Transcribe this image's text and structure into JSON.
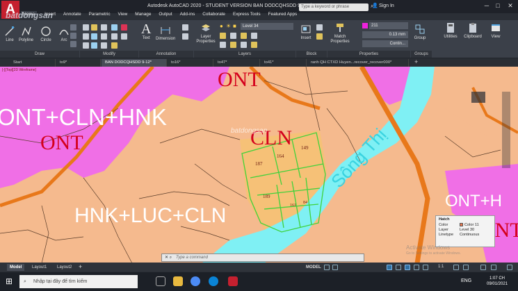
{
  "app": {
    "logo": "A",
    "title": "Autodesk AutoCAD 2020 - STUDENT VERSION   BAN DODCQHSDD 9-12.dwg",
    "search_placeholder": "Type a keyword or phrase",
    "sign_in": "Sign In",
    "watermark_site": "batdongsan",
    "watermark_site_sub": ".com.vn"
  },
  "menu": [
    "Home",
    "Insert",
    "Annotate",
    "Parametric",
    "View",
    "Manage",
    "Output",
    "Add-ins",
    "Collaborate",
    "Express Tools",
    "Featured Apps"
  ],
  "ribbon": {
    "draw_tools": [
      "Line",
      "Polyline",
      "Circle",
      "Arc"
    ],
    "panels": {
      "draw": "Draw",
      "modify": "Modify",
      "annotation": "Annotation",
      "layers": "Layers",
      "block": "Block",
      "properties": "Properties",
      "groups": "Groups"
    },
    "buttons": {
      "text": "Text",
      "dimension": "Dimension",
      "layer_properties": "Layer Properties",
      "insert": "Insert",
      "match_properties": "Match Properties",
      "group": "Group",
      "utilities": "Utilities",
      "clipboard": "Clipboard",
      "view": "View"
    },
    "layer_current": "Level 34",
    "color_value": "211",
    "lineweight_value": "0.13 mm",
    "linetype_value": "Contin..."
  },
  "file_tabs": [
    "Start",
    "to9*",
    "BAN DODCQHSDD 9-12*",
    "to16*",
    "to47*",
    "to41*",
    "ranh QH CTXD Huyen...recover_recover000*"
  ],
  "viewport": {
    "label": "[-][Top][2D Wireframe]",
    "map_labels": [
      "ONT",
      "ONT+CLN+HNK",
      "ONT",
      "CLN",
      "HNK+LUC+CLN",
      "ONT+H",
      "ONT",
      "CLN"
    ],
    "parcel_numbers": [
      "149",
      "164",
      "187",
      "189",
      "161",
      "84"
    ],
    "river_text": "Sông Thị",
    "map_watermark": "batdongsan"
  },
  "hatch_tooltip": {
    "title": "Hatch",
    "rows": [
      {
        "key": "Color",
        "value": "Color 11"
      },
      {
        "key": "Layer",
        "value": "Level 30"
      },
      {
        "key": "Linetype",
        "value": "Continuous"
      }
    ]
  },
  "activate_windows": {
    "line1": "Activate Windows",
    "line2": "Go to Settings to activate Windows."
  },
  "command_line": {
    "placeholder": "Type a command"
  },
  "statusbar": {
    "tabs": [
      "Model",
      "Layout1",
      "Layout2"
    ],
    "model_button": "MODEL",
    "scale": "1:1"
  },
  "taskbar": {
    "search_placeholder": "Nhập tại đây để tìm kiếm",
    "language": "ENG",
    "time": "1:07 CH",
    "date": "09/01/2021"
  },
  "colors": {
    "ont_pink": "#f06fe6",
    "hnk_orange": "#f5ba8e",
    "road_orange": "#e8781a",
    "river_cyan": "#7ff0f4",
    "label_red": "#d4001c",
    "parcel_green": "#3fd23a"
  }
}
